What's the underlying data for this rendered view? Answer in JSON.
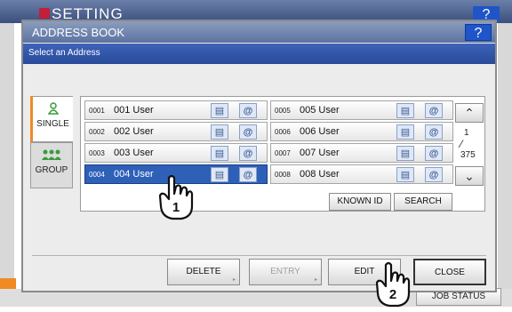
{
  "background": {
    "title": "SETTING",
    "help_label": "?",
    "job_status_label": "JOB STATUS"
  },
  "dialog": {
    "title": "ADDRESS BOOK",
    "help_label": "?",
    "subtitle": "Select an Address"
  },
  "tabs": {
    "single": "SINGLE",
    "group": "GROUP"
  },
  "entries": [
    {
      "num": "0001",
      "name": "001 User",
      "selected": false
    },
    {
      "num": "0002",
      "name": "002 User",
      "selected": false
    },
    {
      "num": "0003",
      "name": "003 User",
      "selected": false
    },
    {
      "num": "0004",
      "name": "004 User",
      "selected": true
    },
    {
      "num": "0005",
      "name": "005 User",
      "selected": false
    },
    {
      "num": "0006",
      "name": "006 User",
      "selected": false
    },
    {
      "num": "0007",
      "name": "007 User",
      "selected": false
    },
    {
      "num": "0008",
      "name": "008 User",
      "selected": false
    }
  ],
  "icons": {
    "fax": "fax-icon",
    "email": "email-icon"
  },
  "pagination": {
    "current": "1",
    "total": "375"
  },
  "buttons": {
    "known_id": "KNOWN ID",
    "search": "SEARCH",
    "delete": "DELETE",
    "entry": "ENTRY",
    "edit": "EDIT",
    "close": "CLOSE"
  },
  "callouts": {
    "step1": "1",
    "step2": "2"
  },
  "colors": {
    "selected_row": "#2f60b8",
    "header": "#284a9a",
    "accent": "#f08a24"
  }
}
